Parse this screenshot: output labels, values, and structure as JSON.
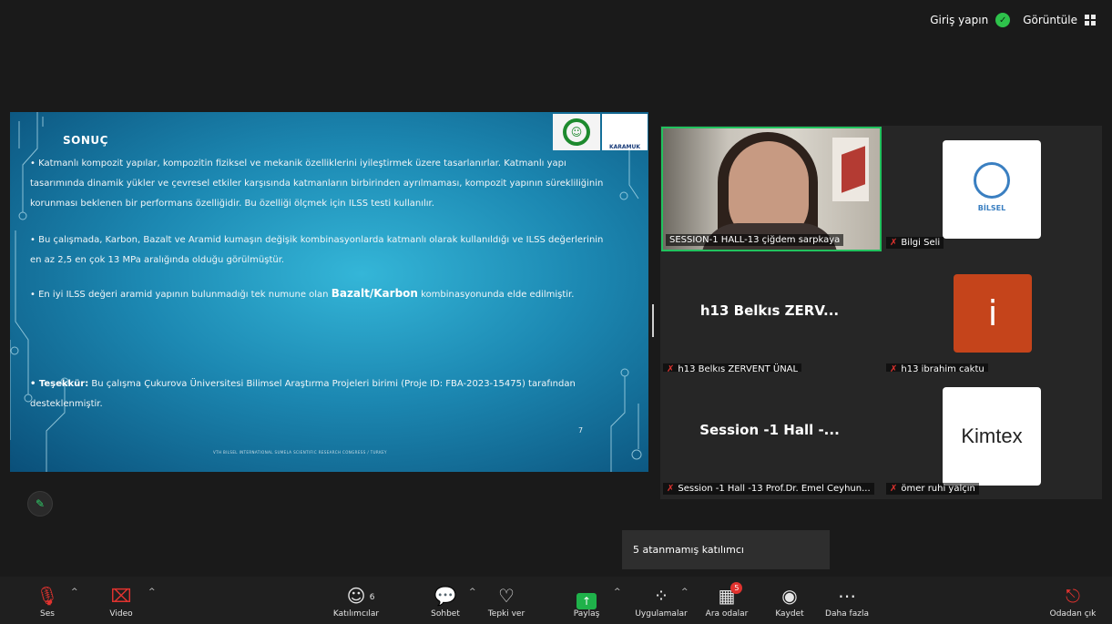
{
  "topbar": {
    "signin": "Giriş yapın",
    "view": "Görüntüle"
  },
  "slide": {
    "title": "SONUÇ",
    "p1": "•  Katmanlı kompozit yapılar, kompozitin fiziksel ve mekanik özelliklerini iyileştirmek üzere tasarlanırlar. Katmanlı yapı tasarımında dinamik yükler ve çevresel etkiler karşısında katmanların birbirinden ayrılmaması, kompozit yapının sürekliliğinin korunması beklenen bir performans özelliğidir. Bu özelliği ölçmek için ILSS testi kullanılır.",
    "p2": "•   Bu çalışmada, Karbon, Bazalt ve Aramid kumaşın değişik kombinasyonlarda katmanlı olarak kullanıldığı ve ILSS değerlerinin en az 2,5 en çok 13 MPa aralığında olduğu görülmüştür.",
    "p3_pre": "•   En iyi ILSS değeri aramid yapının bulunmadığı tek numune olan ",
    "p3_bold": "Bazalt/Karbon",
    "p3_post": " kombinasyonunda elde edilmiştir.",
    "p4_bold": "• Teşekkür:",
    "p4": " Bu çalışma Çukurova Üniversitesi Bilimsel Araştırma Projeleri birimi (Proje ID: FBA-2023-15475) tarafından desteklenmiştir.",
    "page": "7",
    "footer": "VTH BILSEL INTERNATIONAL SUMELA SCIENTIFIC RESEARCH CONGRESS / TURKEY",
    "logo2_text": "KARAMUK"
  },
  "participants": [
    {
      "label": "SESSION-1 HALL-13 çiğdem sarpkaya"
    },
    {
      "label": "Bilgi Seli",
      "logo_text": "BİLSEL"
    },
    {
      "label": "h13 Belkıs ZERVENT ÜNAL",
      "display": "h13 Belkıs ZERV..."
    },
    {
      "label": "h13 ibrahim çaktu",
      "initial": "i"
    },
    {
      "label": "Session -1 Hall -13 Prof.Dr. Emel Ceyhun...",
      "display": "Session -1 Hall -..."
    },
    {
      "label": "ömer ruhi yalçın",
      "logo_text": "Kimtex"
    }
  ],
  "tooltip": "5 atanmamış katılımcı",
  "toolbar": {
    "audio": "Ses",
    "video": "Video",
    "participants": "Katılımcılar",
    "participants_count": "6",
    "chat": "Sohbet",
    "react": "Tepki ver",
    "share": "Paylaş",
    "apps": "Uygulamalar",
    "rooms": "Ara odalar",
    "rooms_badge": "5",
    "record": "Kaydet",
    "more": "Daha fazla",
    "leave": "Odadan çık"
  }
}
